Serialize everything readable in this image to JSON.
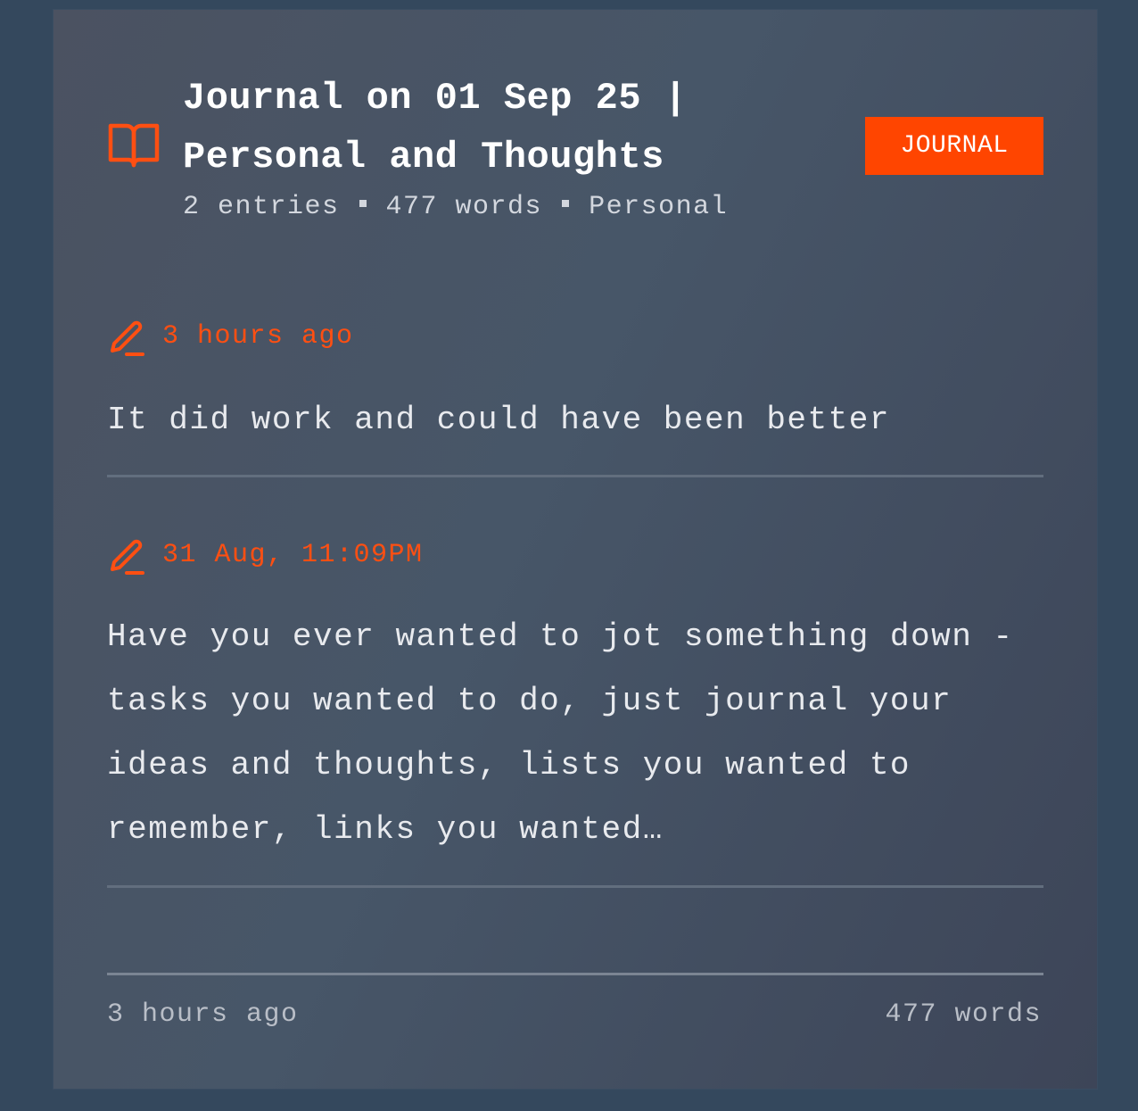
{
  "card": {
    "title": "Journal on 01 Sep 25 | Personal and Thoughts",
    "badge": "JOURNAL",
    "icon": "book-open-icon",
    "meta": {
      "entries": "2 entries",
      "words": "477 words",
      "category": "Personal"
    },
    "entries": [
      {
        "icon": "pencil-icon",
        "time": "3 hours ago",
        "text": "It did work and could have been better"
      },
      {
        "icon": "pencil-icon",
        "time": "31 Aug, 11:09PM",
        "text": "Have you ever wanted to jot something down - tasks you wanted to do, just journal your ideas and thoughts, lists you wanted to remember, links you wanted…"
      }
    ],
    "footer": {
      "updated": "3 hours ago",
      "word_count": "477 words"
    }
  },
  "colors": {
    "accent": "#ff4500",
    "page_background": "#34485d",
    "card_background": "#475668",
    "text": "#e8eaee"
  }
}
